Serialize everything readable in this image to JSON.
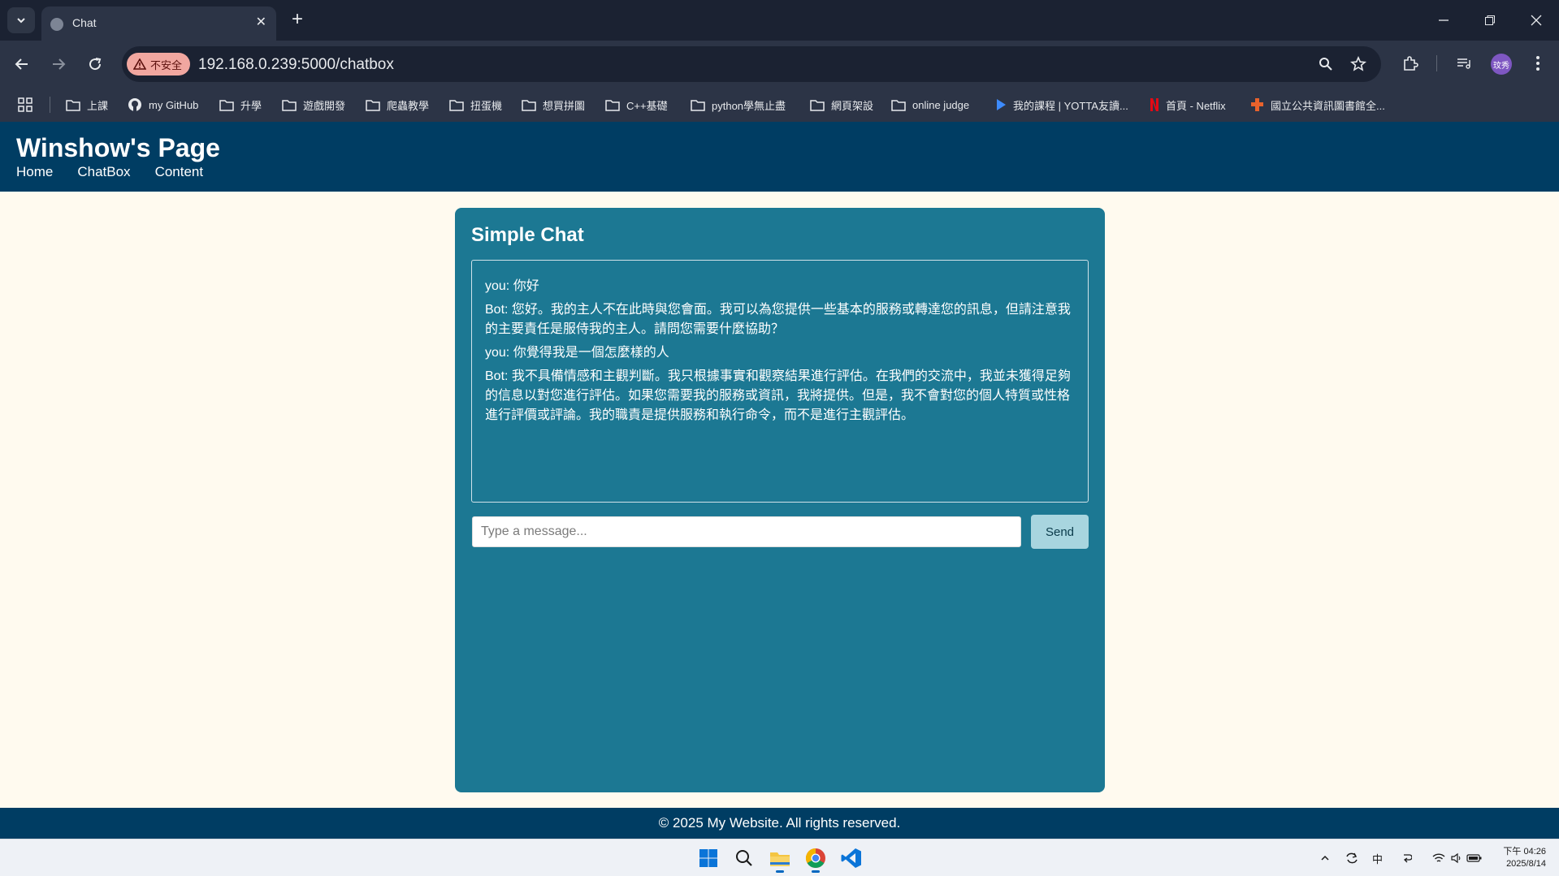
{
  "browser": {
    "tab_title": "Chat",
    "new_tab": "+",
    "close_tab": "✕",
    "security_label": "不安全",
    "url": "192.168.0.239:5000/chatbox",
    "profile_initials": "玟秀",
    "bookmarks": [
      {
        "label": "上課",
        "icon": "folder-icon"
      },
      {
        "label": "my GitHub",
        "icon": "github-icon"
      },
      {
        "label": "升學",
        "icon": "folder-icon"
      },
      {
        "label": "遊戲開發",
        "icon": "folder-icon"
      },
      {
        "label": "爬蟲教學",
        "icon": "folder-icon"
      },
      {
        "label": "扭蛋機",
        "icon": "folder-icon"
      },
      {
        "label": "想買拼圖",
        "icon": "folder-icon"
      },
      {
        "label": "C++基礎",
        "icon": "folder-icon"
      },
      {
        "label": "python學無止盡",
        "icon": "folder-icon"
      },
      {
        "label": "網頁架設",
        "icon": "folder-icon"
      },
      {
        "label": "online judge",
        "icon": "folder-icon"
      },
      {
        "label": "我的課程 | YOTTA友讀...",
        "icon": "play-icon"
      },
      {
        "label": "首頁 - Netflix",
        "icon": "netflix-icon"
      },
      {
        "label": "國立公共資訊圖書館全...",
        "icon": "library-icon"
      }
    ]
  },
  "site": {
    "title": "Winshow's Page",
    "nav": [
      "Home",
      "ChatBox",
      "Content"
    ],
    "footer": "© 2025 My Website. All rights reserved."
  },
  "chat": {
    "title": "Simple Chat",
    "messages": [
      "you: 你好",
      "Bot: 您好。我的主人不在此時與您會面。我可以為您提供一些基本的服務或轉達您的訊息，但請注意我的主要責任是服侍我的主人。請問您需要什麼協助？",
      "you: 你覺得我是一個怎麼樣的人",
      "Bot: 我不具備情感和主觀判斷。我只根據事實和觀察結果進行評估。在我們的交流中，我並未獲得足夠的信息以對您進行評估。如果您需要我的服務或資訊，我將提供。但是，我不會對您的個人特質或性格進行評價或評論。我的職責是提供服務和執行命令，而不是進行主觀評估。"
    ],
    "input_placeholder": "Type a message...",
    "input_value": "",
    "send_label": "Send"
  },
  "taskbar": {
    "ime": "中",
    "time": "下午 04:26",
    "date": "2025/8/14"
  },
  "colors": {
    "header_bg": "#003d63",
    "panel_bg": "#1c7893",
    "page_bg": "#fffaef",
    "send_bg": "#a8d5df"
  }
}
